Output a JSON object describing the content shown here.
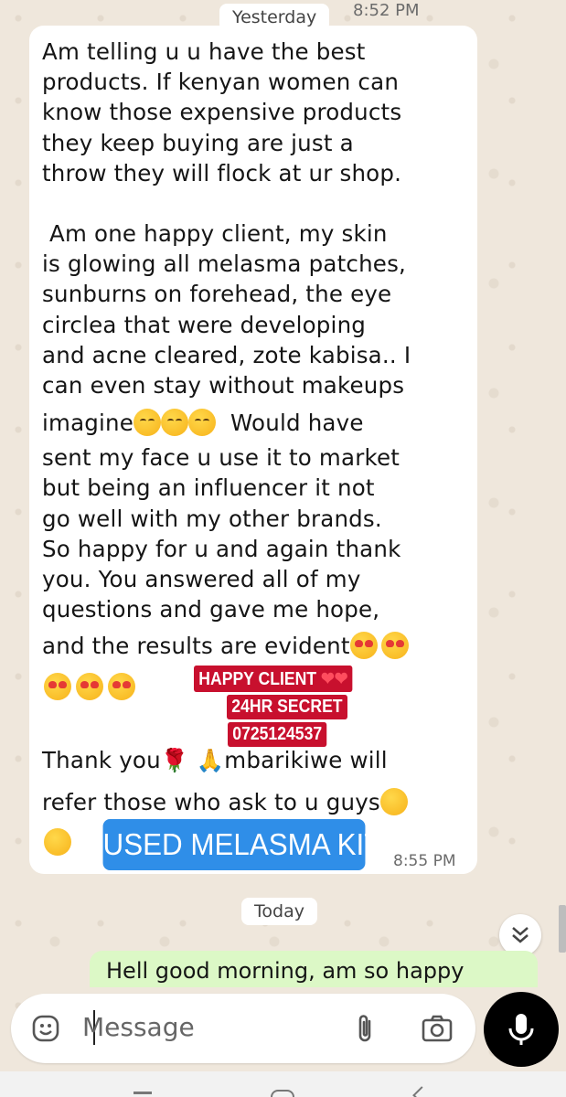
{
  "date_chips": {
    "yesterday": "Yesterday",
    "today": "Today"
  },
  "top_time": "8:52 PM",
  "incoming_message": {
    "lines": [
      "Am telling u u have the best",
      "products. If kenyan women can",
      "know those expensive products",
      "they keep buying are just a",
      "throw they will flock at ur shop.",
      " Am one happy client, my skin",
      "is glowing all melasma patches,",
      "sunburns on forehead, the eye",
      "circlea that were developing",
      "and acne cleared, zote kabisa.. I",
      "can even stay without makeups",
      "imagine",
      "Would have",
      "sent my face u use it to market",
      "but being an influencer it not",
      "go well with my other brands.",
      "So happy for u and again thank",
      "you.  You answered all of my",
      "questions and gave me hope,",
      "and the results are evident",
      "Thank you",
      "mbarikiwe will",
      "refer those who ask to u guys"
    ],
    "time": "8:55 PM"
  },
  "stickers": {
    "happy_client": "HAPPY CLIENT",
    "secret": "24HR SECRET",
    "phone": "0725124537",
    "kit": "USED MELASMA KIT"
  },
  "outgoing_message": {
    "text": "Hell good morning, am so happy"
  },
  "composer": {
    "placeholder": "Message"
  },
  "icons": {
    "emoji": "emoji-icon",
    "attach": "paperclip-icon",
    "camera": "camera-icon",
    "mic": "microphone-icon",
    "scroll": "chevrons-down-icon"
  },
  "colors": {
    "background": "#efe7dc",
    "incoming_bubble": "#ffffff",
    "outgoing_bubble": "#dcf8c6",
    "sticker_red": "#c8102e",
    "sticker_blue": "#2f8ee8",
    "mic_button": "#000000"
  }
}
